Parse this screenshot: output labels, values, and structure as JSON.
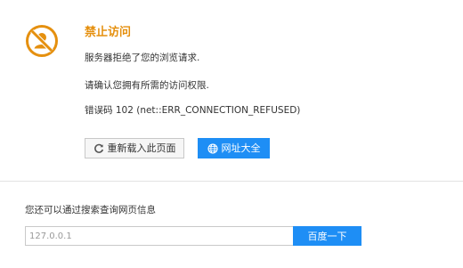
{
  "error": {
    "title": "禁止访问",
    "message": "服务器拒绝了您的浏览请求.",
    "hint": "请确认您拥有所需的访问权限.",
    "code_text": "错误码 102 (net::ERR_CONNECTION_REFUSED)",
    "icon": "blocked-user-icon",
    "accent_color": "#e5900f"
  },
  "actions": {
    "reload_label": "重新载入此页面",
    "reload_icon": "refresh-icon",
    "sites_label": "网址大全",
    "sites_icon": "globe-icon",
    "primary_color": "#1e8ef5"
  },
  "search": {
    "label": "您还可以通过搜索查询网页信息",
    "input_value": "127.0.0.1",
    "button_label": "百度一下"
  }
}
